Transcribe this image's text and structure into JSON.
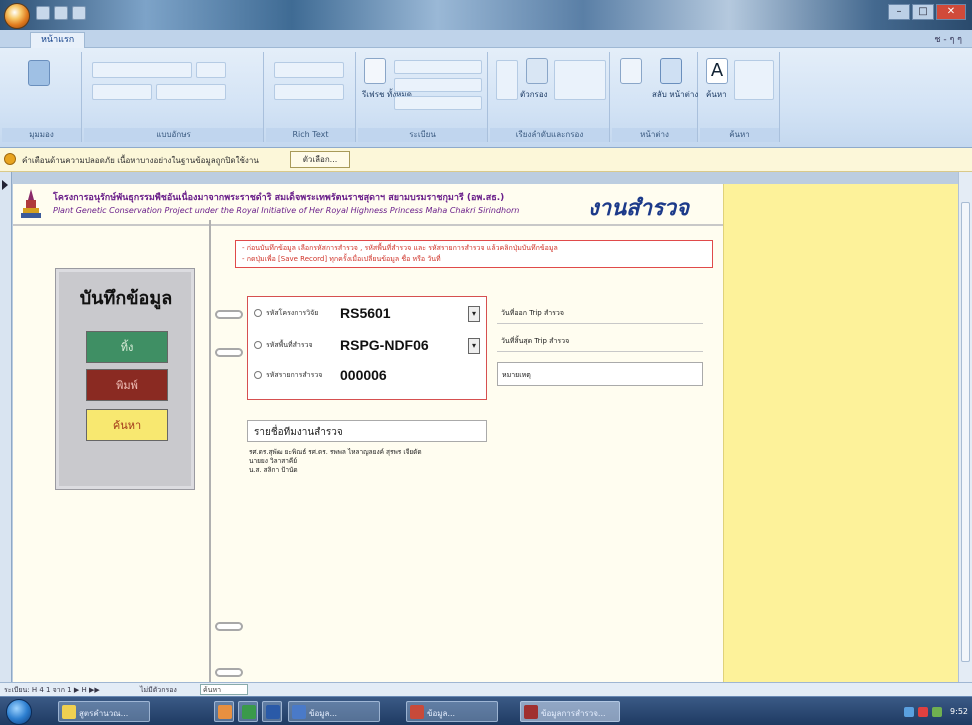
{
  "window": {
    "tab_home": "หน้าแรก",
    "help": "ช - ๆ ๆ"
  },
  "ribbon": {
    "groups": [
      "มุมมอง",
      "แบบอักษร",
      "Rich Text",
      "ระเบียน",
      "เรียงลำดับและกรอง",
      "หน้าต่าง",
      "ค้นหา"
    ],
    "labels": {
      "refresh": "รีเฟรช ทั้งหมด",
      "filter": "ตัวกรอง",
      "find": "ค้นหา",
      "switch": "สลับ หน้าต่าง"
    }
  },
  "security_bar": {
    "message": "คำเตือนด้านความปลอดภัย เนื้อหาบางอย่างในฐานข้อมูลถูกปิดใช้งาน",
    "button": "ตัวเลือก..."
  },
  "form": {
    "org_th": "โครงการอนุรักษ์พันธุกรรมพืชอันเนื่องมาจากพระราชดำริ สมเด็จพระเทพรัตนราชสุดาฯ สยามบรมราชกุมารี (อพ.สธ.)",
    "org_en": "Plant Genetic Conservation Project under the Royal Initiative of Her Royal Highness Princess Maha Chakri Sirindhorn",
    "title": "งานสำรวจ",
    "menu": {
      "title": "บันทึกข้อมูล",
      "save": "ทิ้ง",
      "print": "พิมพ์",
      "search": "ค้นหา"
    },
    "notice": [
      "- ก่อนบันทึกข้อมูล เลือกรหัสการสำรวจ , รหัสพื้นที่สำรวจ และ รหัสรายการสำรวจ แล้วคลิกปุ่มบันทึกข้อมูล",
      "- กดปุ่มเพื่อ [Save Record] ทุกครั้งเมื่อเปลี่ยนข้อมูล ชื่อ หรือ วันที่"
    ],
    "fields": [
      {
        "label": "รหัสโครงการวิจัย",
        "value": "RS5601"
      },
      {
        "label": "รหัสพื้นที่สำรวจ",
        "value": "RSPG-NDF06"
      },
      {
        "label": "รหัสรายการสำรวจ",
        "value": "000006"
      }
    ],
    "trip": {
      "start": "วันที่ออก Trip สำรวจ",
      "end": "วันที่สิ้นสุด Trip สำรวจ",
      "remark": "หมายเหตุ"
    },
    "police_label": "รายชื่อทีมงานสำรวจ",
    "police_list": [
      "รศ.ดร.สุพัฒ ยะพิณธ์ รศ.ดร. รพพล ไหลาญลยงค์ สุรพร เจียดัด",
      "นายยง วิลาสาคีย์",
      "น.ส. สลิกา ป้านัด"
    ]
  },
  "navbar": {
    "record": "ระเบียน: H 4 1 จาก 1 ▶ H ▶▶",
    "filter": "ไม่มีตัวกรอง",
    "search": "ค้นหา"
  },
  "taskbar": {
    "items": [
      "สูตรคำนวณ...",
      "",
      "",
      "",
      "ข้อมูล...",
      "ข้อมูล...",
      "ข้อมูลการสำรวจ..."
    ],
    "clock": "9:52"
  },
  "colors": {
    "save_btn": "#3f8f64",
    "print_btn": "#8a2a22",
    "search_btn": "#f8e870",
    "title_blue": "#1c3a8a",
    "notice_red": "#d0342a"
  }
}
